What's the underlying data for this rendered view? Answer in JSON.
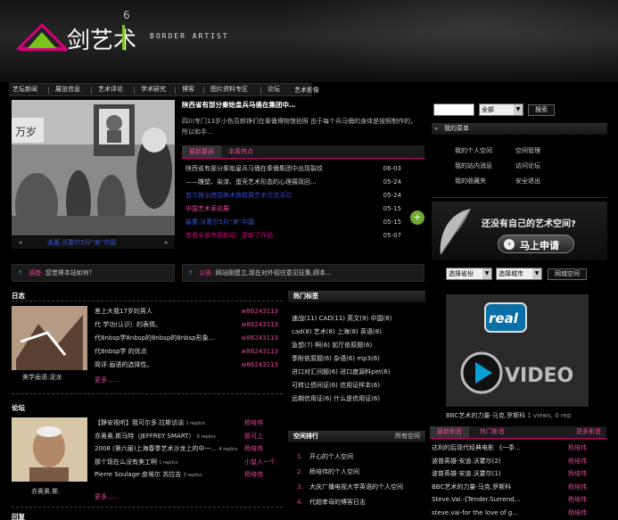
{
  "header": {
    "logo_glyphs": "剑艺术",
    "logo_number": "6",
    "tagline": "BORDER ARTIST"
  },
  "nav": {
    "items": [
      "艺坛新闻",
      "展览信息",
      "艺术评论",
      "学术研究",
      "博客",
      "图片资料专区",
      "论坛",
      "艺术影像"
    ],
    "active_index": 6
  },
  "feature": {
    "caption": "装置:沃霍尔5月“来”中国",
    "caption_prefix": "«",
    "caption_suffix": "»",
    "headline": "陕西省有部分秦始皇兵马俑在集团中…",
    "summary": "四川专门13岁小伤员郎铮们在秦俑博物馆拍照    由于每个兵马俑的身体是按照制作的，所以和手…",
    "tabs": [
      "最新要闻",
      "本周热点"
    ]
  },
  "news_list": [
    {
      "title": "陕西省有部分秦始皇兵马俑在秦俑集团中出现裂纹",
      "date": "06-03",
      "color": "#cccccc"
    },
    {
      "title": "——雕塑、染漆、蛋壳艺术形态的心理展现回...",
      "date": "05-24",
      "color": "#cccccc"
    },
    {
      "title": "首次推出跨国美术馆联展艺术交流活动",
      "date": "05-24",
      "color": "#3344cc"
    },
    {
      "title": "中国艺术家巡展",
      "date": "05-15",
      "color": "#e8459a"
    },
    {
      "title": "装置:沃霍尔5月“来”中国",
      "date": "05-15",
      "color": "#3a55d0"
    },
    {
      "title": "查看全部专题新闻：更新了作品",
      "date": "05-07",
      "color": "#d4007a"
    }
  ],
  "notices": [
    {
      "icon": "↑",
      "label": "调查:",
      "text": "您觉得本站如何？"
    },
    {
      "icon": "↑",
      "label": "公告:",
      "text": "网站刚建立,现在对外招往意见征集,顾本..."
    }
  ],
  "blog": {
    "title": "日志",
    "items": [
      {
        "title": "差上大我17岁的男人",
        "user": "w86243113"
      },
      {
        "title": "代 学功(认识）的表情。",
        "user": "w86243113"
      },
      {
        "title": "代8nbsp学8nbsp的8nbsp的8nbsp形象...",
        "user": "w86243113"
      },
      {
        "title": "代8nbsp学 的优点",
        "user": "w86243113"
      },
      {
        "title": "简评:画语的选择性。",
        "user": "w86243113"
      }
    ],
    "thumb_caption": "美学画语:泥龙",
    "more": "更多......"
  },
  "forum": {
    "title": "论坛",
    "items": [
      {
        "title": "【静安视听】我可尔多.拉斯访谈",
        "replies": "1 replics",
        "user": "杨培伟"
      },
      {
        "title": "亦奥奥.斯马特（JEFFREY SMART）",
        "replies": "6 replics",
        "user": "那可上"
      },
      {
        "title": "2008 (第六届)上海春季艺术沙龙上的中一...",
        "replies": "4 replics",
        "user": "杨培伟"
      },
      {
        "title": "那个现在么没有美工啊",
        "replies": "1 replics",
        "user": "小鼠人一个"
      },
      {
        "title": "Pierre Soulage-皮埃尔  苏拉吉",
        "replies": "3 replics",
        "user": "杨培伟"
      }
    ],
    "thumb_caption": "亦奥奥.斯.",
    "more": "更多......"
  },
  "bottom_cut": "回复",
  "hot_tags": {
    "title": "热门标签",
    "lines": [
      "速战(11) CAD(11) 英文(9) 中国(8)",
      "cad(8) 艺术(8) 上海(8) 英语(8)",
      "急想(7) 啊(6) 前厅依原题(6)",
      "季盼依原题(6) 杂语(6) mp3(6)",
      "进口对汇间题(6) 进口度源料pet(6)",
      "可转让债间证(6) 信用证样本(6)",
      "远期信用证(6) 什么是信用证(6)"
    ]
  },
  "space": {
    "title": "空间排行",
    "link": "所有空间",
    "items": [
      "开心的个人空间",
      "杨培伟的个人空间",
      "大庆广播电视大学英语的个人空间",
      "代超孝母的博客日志"
    ]
  },
  "search": {
    "select": "全部",
    "button": "搜索"
  },
  "my_menu": {
    "title": "我的菜单",
    "items": [
      [
        "我的个人空间",
        "空间管理"
      ],
      [
        "我的站内消息",
        "访问论坛"
      ],
      [
        "我的收藏夹",
        "安全退出"
      ]
    ]
  },
  "apply": {
    "question": "还没有自己的艺术空间?",
    "button": "马上申请"
  },
  "space_select": {
    "province": "选择省份",
    "city": "选择城市",
    "button": "网城空间"
  },
  "video": {
    "brand_top": "real",
    "brand_bottom": "VIDEO",
    "caption": "BBC艺术的力量-马克.罗斯科",
    "meta": "1 views, 0 rep"
  },
  "video_list": {
    "tabs": [
      "最新影音",
      "热门影音"
    ],
    "more": "更多影音",
    "items": [
      {
        "title": "达利的后现代经典电影 《一条...",
        "user": "杨培伟"
      },
      {
        "title": "波普英雄-安迪.沃霍尔(2)",
        "user": "杨培伟"
      },
      {
        "title": "波普英雄-安迪.沃霍尔(1)",
        "user": "杨培伟"
      },
      {
        "title": "BBC艺术的力量-马克.罗斯科",
        "user": "杨培伟"
      },
      {
        "title": "Steve.Vai.-[Tender.Surrend...",
        "user": "杨培伟"
      },
      {
        "title": "steve.vai-for the love of g...",
        "user": "杨培伟"
      }
    ]
  },
  "colors": {
    "accent": "#d4007a",
    "pink": "#e8459a",
    "logo_green": "#7ac41c",
    "link_blue": "#3a55d0"
  }
}
